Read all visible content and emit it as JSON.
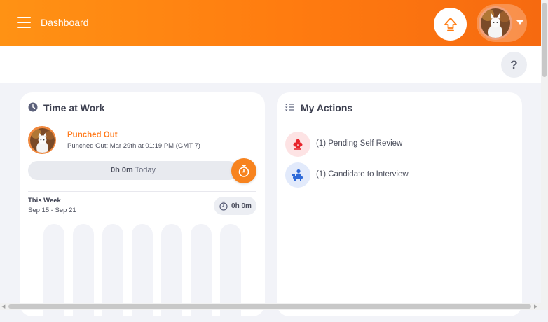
{
  "header": {
    "title": "Dashboard",
    "menu_icon": "hamburger-menu-icon",
    "upgrade_icon": "upgrade-arrow-icon",
    "profile_menu_icon": "caret-down-icon",
    "help_label": "?"
  },
  "colors": {
    "brand_orange": "#ff7b10",
    "accent_orange": "#f7831e",
    "pending_review": "#e8242b",
    "candidate": "#2f6ad8"
  },
  "time_at_work": {
    "title": "Time at Work",
    "title_icon": "clock-icon",
    "status": "Punched Out",
    "detail": "Punched Out: Mar 29th at 01:19 PM (GMT 7)",
    "today_duration": "0h 0m",
    "today_label": "Today",
    "punch_icon": "stopwatch-icon",
    "week_label": "This Week",
    "week_range": "Sep 15 - Sep 21",
    "week_total": "0h 0m",
    "week_total_icon": "timer-icon",
    "daily_bars": 7
  },
  "my_actions": {
    "title": "My Actions",
    "title_icon": "list-check-icon",
    "items": [
      {
        "label": "(1) Pending Self Review",
        "icon": "self-review-icon"
      },
      {
        "label": "(1) Candidate to Interview",
        "icon": "interview-candidate-icon"
      }
    ]
  }
}
